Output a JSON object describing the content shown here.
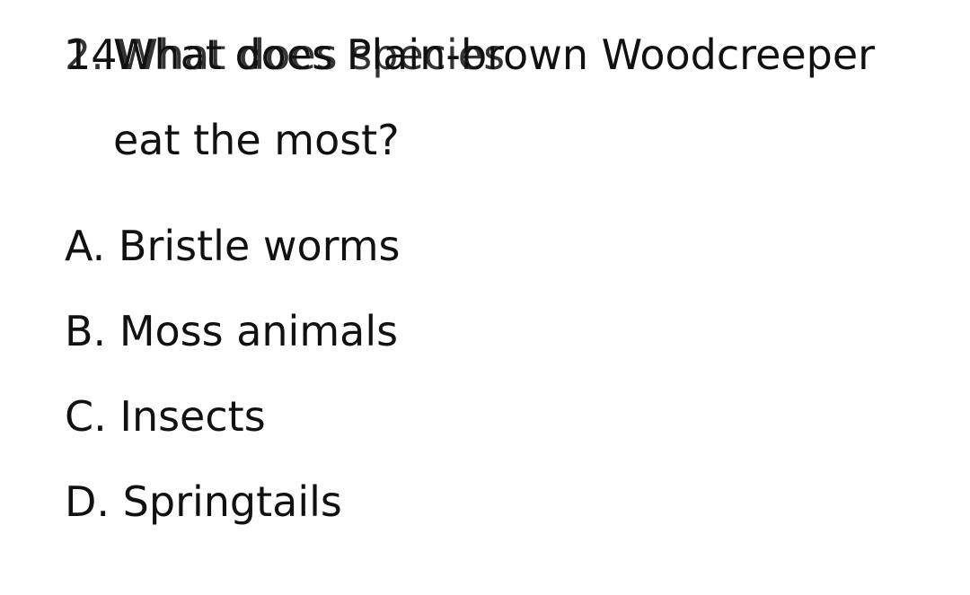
{
  "question": {
    "number": "14.",
    "text_line1": "What does Plain-brown Woodcreeper",
    "text_line2": "eat the most?",
    "overlay_text": "2. What does species"
  },
  "options": [
    {
      "letter": "A.",
      "text": "Bristle worms"
    },
    {
      "letter": "B.",
      "text": "Moss animals"
    },
    {
      "letter": "C.",
      "text": "Insects"
    },
    {
      "letter": "D.",
      "text": "Springtails"
    }
  ]
}
